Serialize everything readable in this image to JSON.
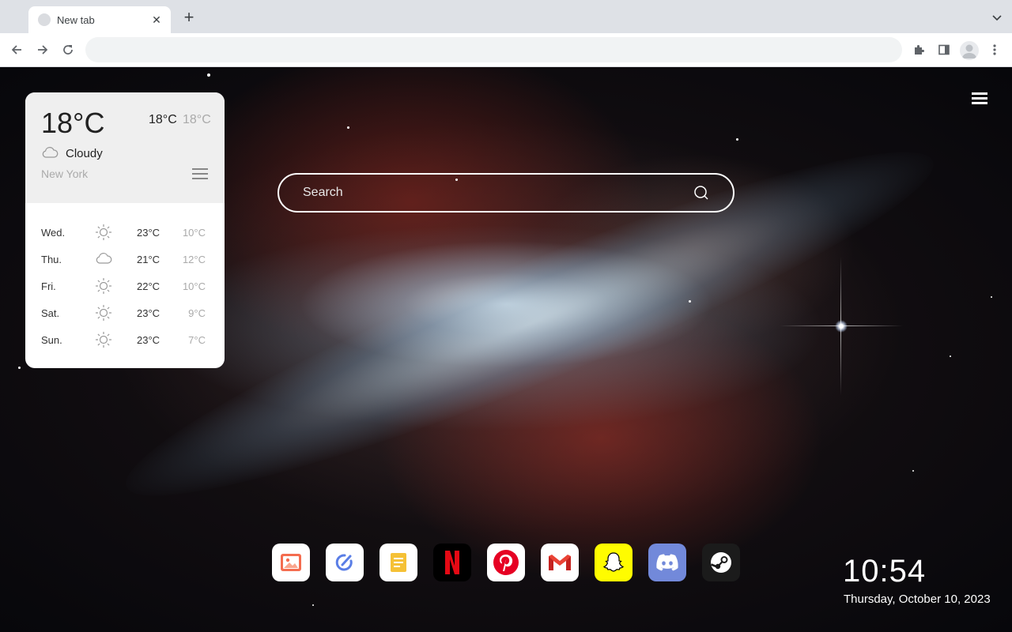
{
  "browser": {
    "tab_title": "New tab",
    "tab_close": "✕",
    "new_tab": "+",
    "omnibox_value": ""
  },
  "weather": {
    "current_temp": "18°C",
    "high": "18°C",
    "low": "18°C",
    "condition": "Cloudy",
    "condition_icon": "cloud-icon",
    "city": "New York",
    "forecast": [
      {
        "day": "Wed.",
        "icon": "sun-icon",
        "high": "23°C",
        "low": "10°C"
      },
      {
        "day": "Thu.",
        "icon": "cloud-icon",
        "high": "21°C",
        "low": "12°C"
      },
      {
        "day": "Fri.",
        "icon": "sun-icon",
        "high": "22°C",
        "low": "10°C"
      },
      {
        "day": "Sat.",
        "icon": "sun-icon",
        "high": "23°C",
        "low": "9°C"
      },
      {
        "day": "Sun.",
        "icon": "sun-icon",
        "high": "23°C",
        "low": "7°C"
      }
    ]
  },
  "search": {
    "placeholder": "Search"
  },
  "dock": [
    {
      "name": "photos",
      "icon": "photo-icon",
      "color": "#ffffff"
    },
    {
      "name": "todo",
      "icon": "check-pen-icon",
      "color": "#ffffff"
    },
    {
      "name": "notes",
      "icon": "note-icon",
      "color": "#ffffff"
    },
    {
      "name": "netflix",
      "icon": "netflix-icon",
      "color": "#000000"
    },
    {
      "name": "pinterest",
      "icon": "pinterest-icon",
      "color": "#ffffff"
    },
    {
      "name": "gmail",
      "icon": "gmail-icon",
      "color": "#ffffff"
    },
    {
      "name": "snapchat",
      "icon": "snapchat-icon",
      "color": "#fffc00"
    },
    {
      "name": "discord",
      "icon": "discord-icon",
      "color": "#7289da"
    },
    {
      "name": "steam",
      "icon": "steam-icon",
      "color": "#1b1b1b"
    }
  ],
  "clock": {
    "time": "10:54",
    "date": "Thursday, October 10, 2023"
  }
}
